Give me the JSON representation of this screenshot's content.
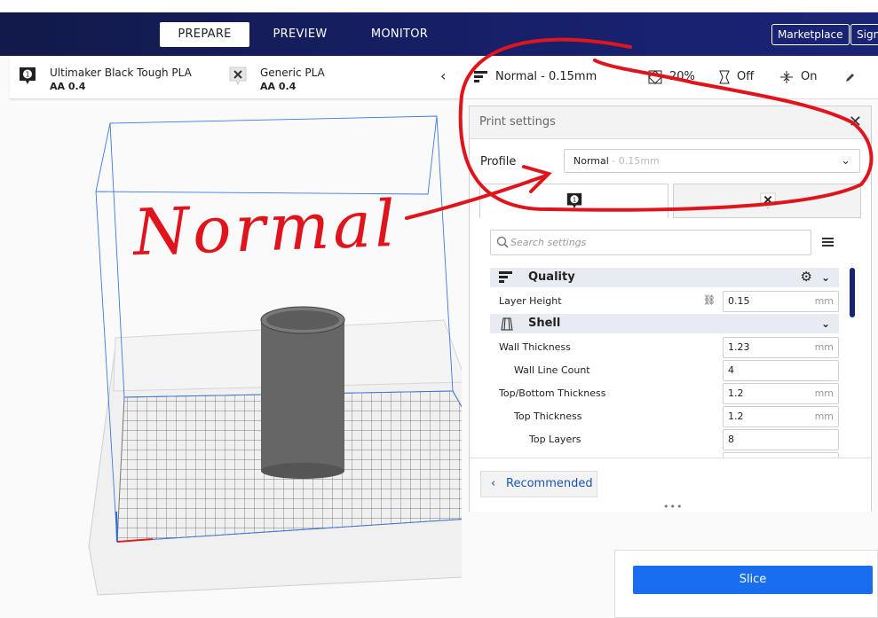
{
  "stages": [
    {
      "label": "PREPARE",
      "active": true
    },
    {
      "label": "PREVIEW",
      "active": false
    },
    {
      "label": "MONITOR",
      "active": false
    }
  ],
  "top_buttons": {
    "marketplace": "Marketplace",
    "signin": "Sign"
  },
  "extruders": [
    {
      "index": "1",
      "material": "Ultimaker Black Tough PLA",
      "nozzle": "AA 0.4"
    },
    {
      "index": "",
      "material": "Generic PLA",
      "nozzle": "AA 0.4"
    }
  ],
  "print_bar": {
    "profile": "Normal - 0.15mm",
    "infill": "20%",
    "support": "Off",
    "adhesion": "On"
  },
  "panel": {
    "title": "Print settings",
    "profile_label": "Profile",
    "profile_value": "Normal",
    "profile_sub": " - 0.15mm",
    "tab1_index": "1",
    "search_placeholder": "Search settings",
    "recommended_label": "Recommended"
  },
  "categories": {
    "quality": "Quality",
    "shell": "Shell"
  },
  "settings": [
    {
      "label": "Layer Height",
      "value": "0.15",
      "unit": "mm"
    },
    {
      "label": "Wall Thickness",
      "value": "1.23",
      "unit": "mm"
    },
    {
      "label": "Wall Line Count",
      "value": "4",
      "unit": ""
    },
    {
      "label": "Top/Bottom Thickness",
      "value": "1.2",
      "unit": "mm"
    },
    {
      "label": "Top Thickness",
      "value": "1.2",
      "unit": "mm"
    },
    {
      "label": "Top Layers",
      "value": "8",
      "unit": ""
    }
  ],
  "slice_label": "Slice",
  "annotation": "Normal",
  "colors": {
    "accent": "#196ef0",
    "header": "#17206a",
    "annotation": "#e0141c"
  }
}
